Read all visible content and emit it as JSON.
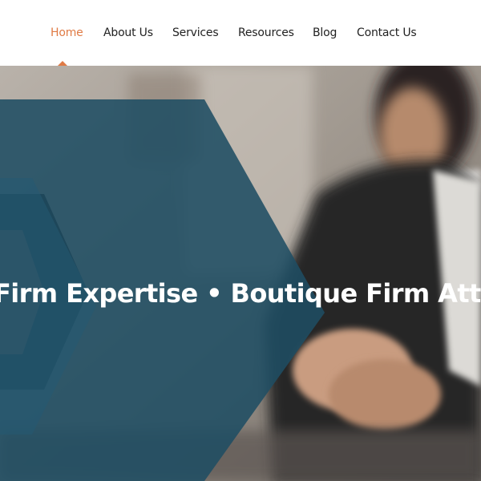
{
  "nav": {
    "items": [
      {
        "label": "Home",
        "active": true
      },
      {
        "label": "About Us",
        "active": false
      },
      {
        "label": "Services",
        "active": false
      },
      {
        "label": "Resources",
        "active": false
      },
      {
        "label": "Blog",
        "active": false
      },
      {
        "label": "Contact Us",
        "active": false
      }
    ],
    "active_color": "#e07b45",
    "text_color": "#222222"
  },
  "hero": {
    "tagline": "Firm Expertise • Boutique Firm Atten",
    "panel_color": "#1f4d63",
    "accent_color": "#c8643a",
    "image": "blurred-professional-clasped-hands-photo"
  }
}
